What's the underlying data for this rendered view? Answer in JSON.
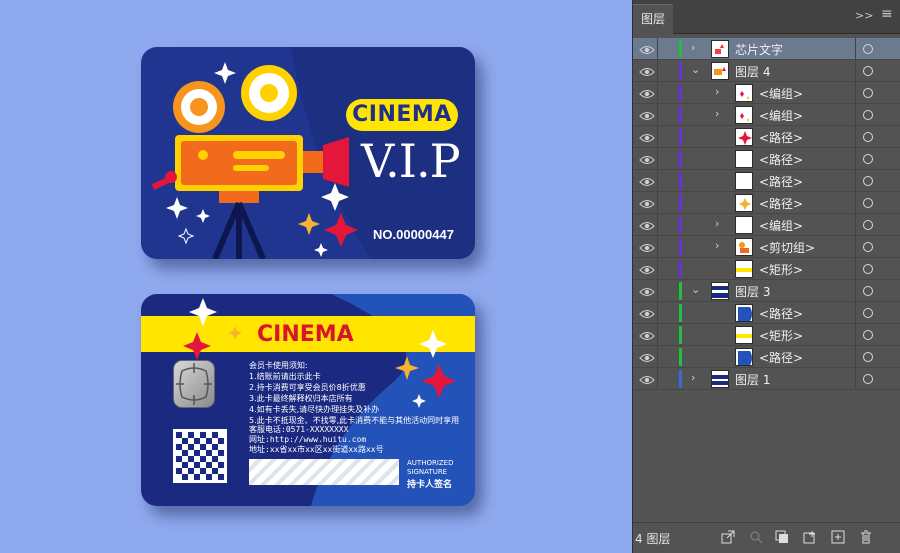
{
  "front_card": {
    "badge": "CINEMA",
    "vip": "V.I.P",
    "number": "NO.00000447"
  },
  "back_card": {
    "title": "CINEMA",
    "notice_title": "会员卡使用须知:",
    "notice_lines": [
      "1.结账前请出示此卡",
      "2.持卡消费可享受会员价8折优惠",
      "3.此卡最终解释权归本店所有",
      "4.如有卡丢失,请尽快办理挂失及补办",
      "5.此卡不抵现金、不找零,此卡消费不能与其他活动同时享用"
    ],
    "phone": "客服电话:0571-XXXXXXXX",
    "website": "网址:http://www.huitu.com",
    "address": "地址:xx省xx市xx区xx街道xx路xx号",
    "authorized_line1": "AUTHORIZED",
    "authorized_line2": "SIGNATURE",
    "signature_label": "持卡人签名"
  },
  "panel": {
    "tab_title": "图层",
    "collapse_glyph": ">>",
    "menu_glyph": "≡",
    "layer_count": "4 图层",
    "layers": [
      {
        "label": "芯片文字",
        "color": "#20c040",
        "arrow": "›",
        "depth": 0,
        "selected": true,
        "icon": "chip-thumb"
      },
      {
        "label": "图层 4",
        "color": "#6a32d8",
        "arrow": "⌄",
        "depth": 0,
        "selected": false,
        "icon": "layer4-thumb"
      },
      {
        "label": "<编组>",
        "color": "#6a32d8",
        "arrow": "›",
        "depth": 1,
        "selected": false,
        "icon": "sparkle-thumb"
      },
      {
        "label": "<编组>",
        "color": "#6a32d8",
        "arrow": "›",
        "depth": 1,
        "selected": false,
        "icon": "sparkle-thumb"
      },
      {
        "label": "<路径>",
        "color": "#6a32d8",
        "arrow": "",
        "depth": 1,
        "selected": false,
        "icon": "red-star-thumb"
      },
      {
        "label": "<路径>",
        "color": "#6a32d8",
        "arrow": "",
        "depth": 1,
        "selected": false,
        "icon": "blank-thumb"
      },
      {
        "label": "<路径>",
        "color": "#6a32d8",
        "arrow": "",
        "depth": 1,
        "selected": false,
        "icon": "blank-thumb"
      },
      {
        "label": "<路径>",
        "color": "#6a32d8",
        "arrow": "",
        "depth": 1,
        "selected": false,
        "icon": "gold-star-thumb"
      },
      {
        "label": "<编组>",
        "color": "#6a32d8",
        "arrow": "›",
        "depth": 1,
        "selected": false,
        "icon": "blank-thumb"
      },
      {
        "label": "<剪切组>",
        "color": "#6a32d8",
        "arrow": "›",
        "depth": 1,
        "selected": false,
        "icon": "projector-thumb"
      },
      {
        "label": "<矩形>",
        "color": "#6a32d8",
        "arrow": "",
        "depth": 1,
        "selected": false,
        "icon": "yellow-rect-thumb"
      },
      {
        "label": "图层 3",
        "color": "#20c040",
        "arrow": "⌄",
        "depth": 0,
        "selected": false,
        "icon": "layer3-thumb"
      },
      {
        "label": "<路径>",
        "color": "#20c040",
        "arrow": "",
        "depth": 1,
        "selected": false,
        "icon": "blue-shape-thumb"
      },
      {
        "label": "<矩形>",
        "color": "#20c040",
        "arrow": "",
        "depth": 1,
        "selected": false,
        "icon": "yellow-rect-thumb"
      },
      {
        "label": "<路径>",
        "color": "#20c040",
        "arrow": "",
        "depth": 1,
        "selected": false,
        "icon": "blue-shape-thumb"
      },
      {
        "label": "图层 1",
        "color": "#3a6ad8",
        "arrow": "›",
        "depth": 0,
        "selected": false,
        "icon": "layer1-thumb"
      }
    ]
  },
  "colors": {
    "canvas_bg": "#8fa9ef",
    "card_navy": "#20358f",
    "accent_yellow": "#ffe500",
    "accent_red": "#d9142c"
  }
}
